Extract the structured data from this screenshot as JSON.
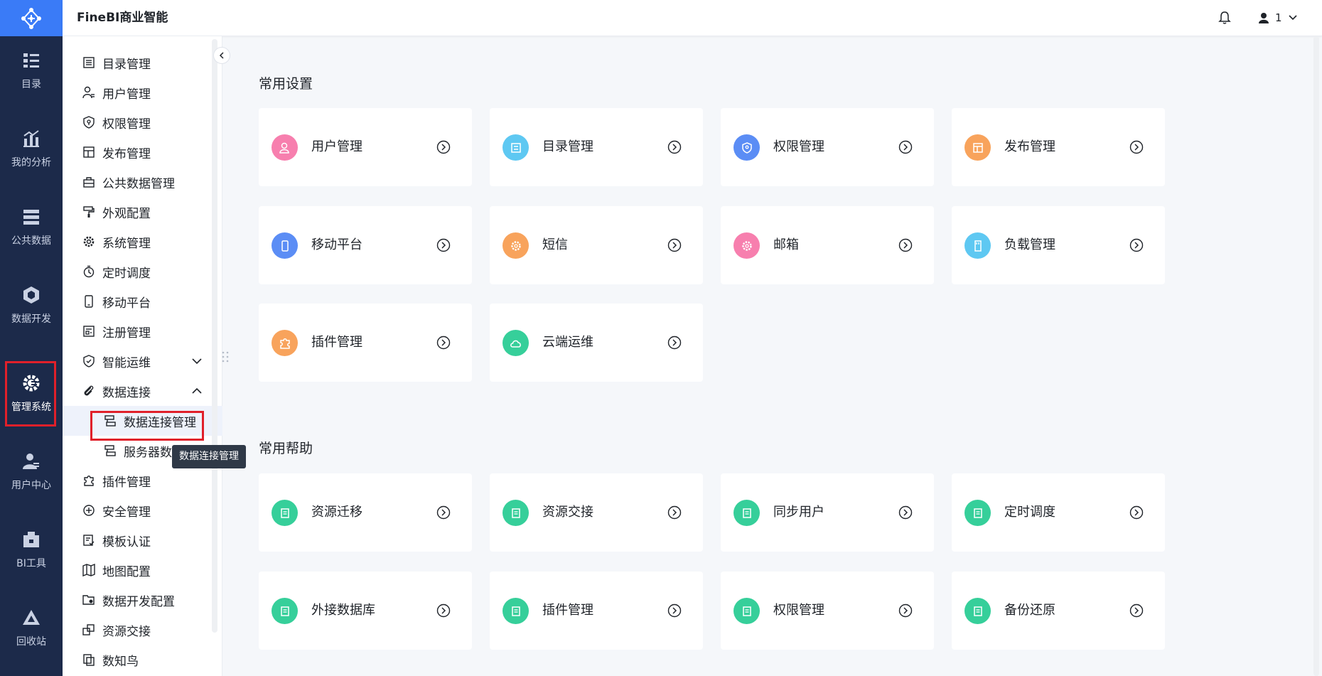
{
  "app": {
    "brand": "FineBI商业智能",
    "user_name": "1"
  },
  "rail": {
    "items": [
      {
        "label": "目录",
        "icon": "catalog-icon"
      },
      {
        "label": "我的分析",
        "icon": "analysis-icon"
      },
      {
        "label": "公共数据",
        "icon": "public-data-icon"
      },
      {
        "label": "数据开发",
        "icon": "data-dev-icon"
      },
      {
        "label": "管理系统",
        "icon": "admin-gear-icon"
      },
      {
        "label": "用户中心",
        "icon": "user-center-icon"
      },
      {
        "label": "BI工具",
        "icon": "toolbox-icon"
      },
      {
        "label": "回收站",
        "icon": "recycle-icon"
      }
    ]
  },
  "sidenav": {
    "items": [
      {
        "label": "目录管理"
      },
      {
        "label": "用户管理"
      },
      {
        "label": "权限管理"
      },
      {
        "label": "发布管理"
      },
      {
        "label": "公共数据管理"
      },
      {
        "label": "外观配置"
      },
      {
        "label": "系统管理"
      },
      {
        "label": "定时调度"
      },
      {
        "label": "移动平台"
      },
      {
        "label": "注册管理"
      },
      {
        "label": "智能运维"
      },
      {
        "label": "数据连接"
      },
      {
        "label": "数据连接管理"
      },
      {
        "label": "服务器数"
      },
      {
        "label": "插件管理"
      },
      {
        "label": "安全管理"
      },
      {
        "label": "模板认证"
      },
      {
        "label": "地图配置"
      },
      {
        "label": "数据开发配置"
      },
      {
        "label": "资源交接"
      },
      {
        "label": "数知鸟"
      }
    ],
    "tooltip": "数据连接管理"
  },
  "main": {
    "common_settings": {
      "title": "常用设置",
      "cards": [
        {
          "label": "用户管理",
          "color": "#f77fae"
        },
        {
          "label": "目录管理",
          "color": "#5ec8f2"
        },
        {
          "label": "权限管理",
          "color": "#5b8df5"
        },
        {
          "label": "发布管理",
          "color": "#f8a35c"
        },
        {
          "label": "移动平台",
          "color": "#5b8df5"
        },
        {
          "label": "短信",
          "color": "#f8a35c"
        },
        {
          "label": "邮箱",
          "color": "#f77fae"
        },
        {
          "label": "负载管理",
          "color": "#5ec8f2"
        },
        {
          "label": "插件管理",
          "color": "#f8a35c"
        },
        {
          "label": "云端运维",
          "color": "#36cf9a"
        }
      ]
    },
    "common_help": {
      "title": "常用帮助",
      "cards": [
        {
          "label": "资源迁移",
          "color": "#36cf9a"
        },
        {
          "label": "资源交接",
          "color": "#36cf9a"
        },
        {
          "label": "同步用户",
          "color": "#36cf9a"
        },
        {
          "label": "定时调度",
          "color": "#36cf9a"
        },
        {
          "label": "外接数据库",
          "color": "#36cf9a"
        },
        {
          "label": "插件管理",
          "color": "#36cf9a"
        },
        {
          "label": "权限管理",
          "color": "#36cf9a"
        },
        {
          "label": "备份还原",
          "color": "#36cf9a"
        }
      ]
    }
  }
}
